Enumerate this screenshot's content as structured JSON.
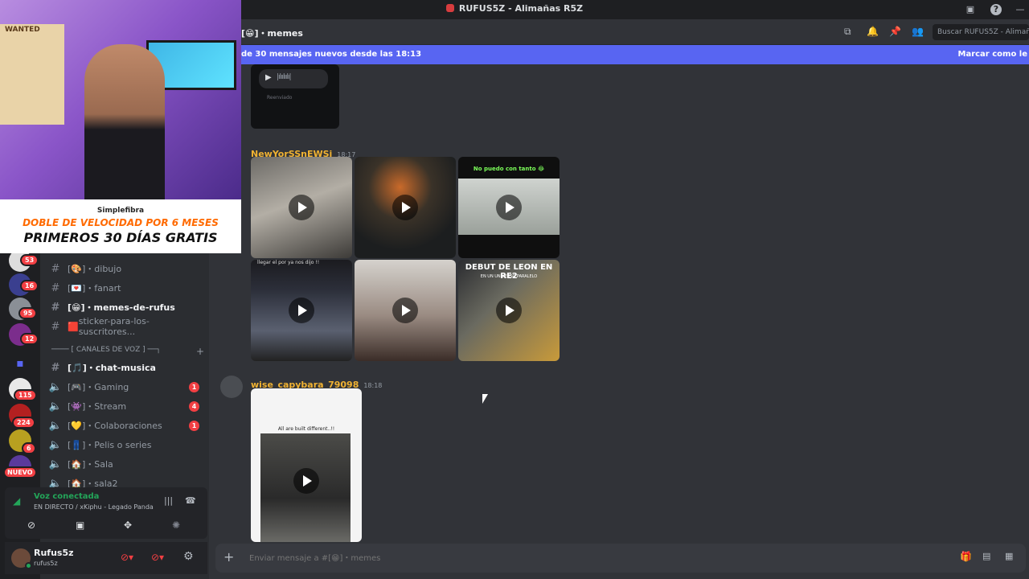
{
  "window": {
    "title": "RUFUS5Z - Alimañas R5Z"
  },
  "channel_header": {
    "name": "memes",
    "prefix": "[😁]・",
    "search_placeholder": "Buscar RUFUS5Z - Alimañ"
  },
  "new_messages_bar": {
    "text": "de 30 mensajes nuevos desde las 18:13",
    "action": "Marcar como le"
  },
  "servers": [
    {
      "badge": "53"
    },
    {
      "badge": "16"
    },
    {
      "badge": "95"
    },
    {
      "badge": "12"
    },
    {
      "badge": ""
    },
    {
      "badge": "115"
    },
    {
      "badge": "224"
    },
    {
      "badge": "6"
    },
    {
      "badge": "NUEVO"
    }
  ],
  "channels": {
    "text": [
      {
        "icon": "[🎨]・",
        "name": "dibujo",
        "active": false
      },
      {
        "icon": "[💌]・",
        "name": "fanart",
        "active": false
      },
      {
        "icon": "[😁]・",
        "name": "memes-de-rufus",
        "active": true
      },
      {
        "icon": "🟥",
        "name": "sticker-para-los-suscritores...",
        "active": false
      }
    ],
    "voice_category": "CANALES DE VOZ",
    "voice": [
      {
        "icon": "[🎵]・",
        "name": "chat-musica",
        "active": true,
        "unread": "",
        "kind": "hash"
      },
      {
        "icon": "[🎮]・",
        "name": "Gaming",
        "active": false,
        "unread": "1",
        "kind": "speaker"
      },
      {
        "icon": "[👾]・",
        "name": "Stream",
        "active": false,
        "unread": "4",
        "kind": "speaker"
      },
      {
        "icon": "[💛]・",
        "name": "Colaboraciones",
        "active": false,
        "unread": "1",
        "kind": "speaker"
      },
      {
        "icon": "[👖]・",
        "name": "Pelis o series",
        "active": false,
        "unread": "",
        "kind": "speaker"
      },
      {
        "icon": "[🏠]・",
        "name": "Sala",
        "active": false,
        "unread": "",
        "kind": "speaker"
      },
      {
        "icon": "[🏠]・",
        "name": "sala2",
        "active": false,
        "unread": "",
        "kind": "speaker"
      }
    ]
  },
  "voice_panel": {
    "status": "Voz conectada",
    "detail": "EN DIRECTO / xKiphu - Legado Panda ..."
  },
  "user_panel": {
    "name": "Rufus5z",
    "tag": "rufus5z"
  },
  "messages": [
    {
      "author": "NewYorSSnEWSi",
      "time": "18:17"
    },
    {
      "author": "wise_capybara_79098",
      "time": "18:18"
    }
  ],
  "media_captions": {
    "top_audio": "Reenviado",
    "tile3": "No puedo con tanto 😂",
    "tile4": "llegar el por ya nos dijo !!",
    "tile6_title": "DEBUT DE LEON EN RE2",
    "tile6_sub": "EN UN UNIVERSO PARALELO",
    "tall": "All are built different..!!"
  },
  "composer": {
    "placeholder": "Enviar mensaje a #[😁]・memes"
  },
  "promo": {
    "brand": "Simplefibra",
    "line1": "DOBLE DE VELOCIDAD POR 6 MESES",
    "line2": "PRIMEROS 30 DÍAS GRATIS",
    "poster": "WANTED"
  },
  "colors": {
    "accent": "#5865f2",
    "author": "#f0b232",
    "badge": "#f23f43",
    "voice_ok": "#23a559"
  }
}
